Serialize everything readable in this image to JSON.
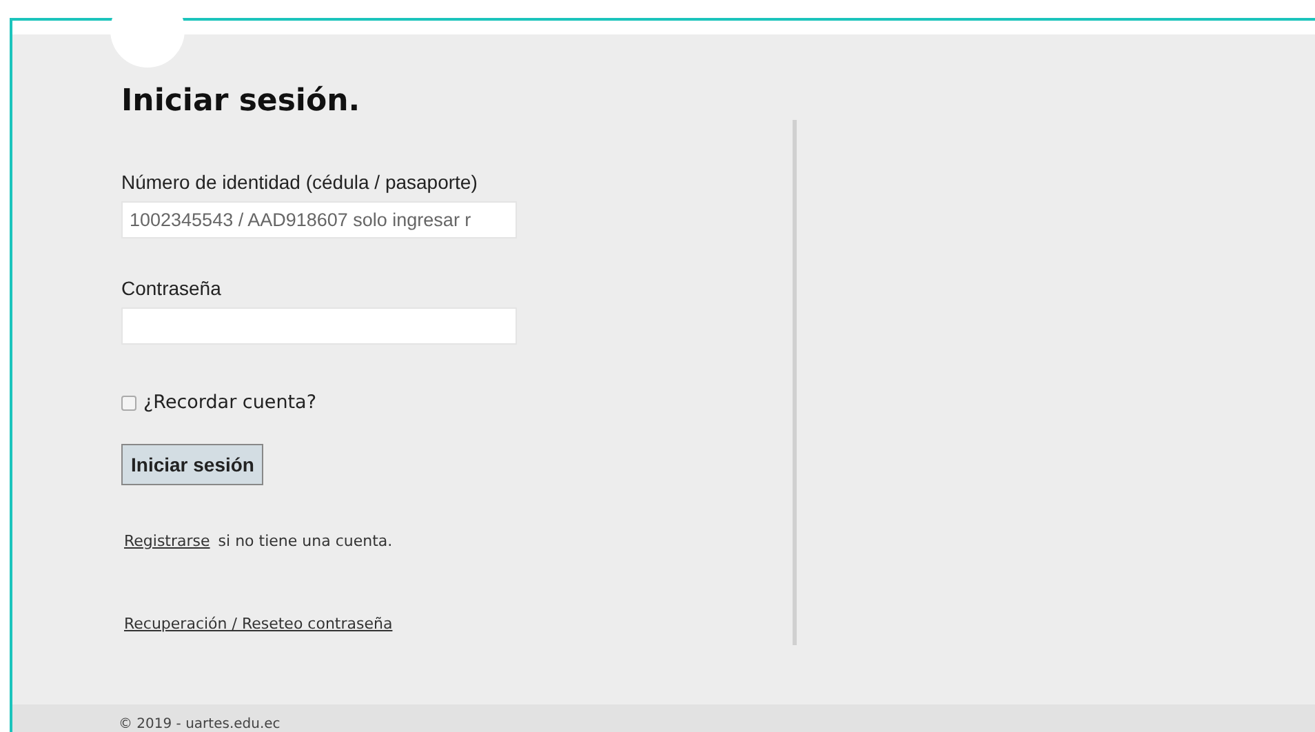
{
  "title": "Iniciar sesión.",
  "fields": [
    {
      "label": "Número de identidad (cédula / pasaporte)",
      "placeholder": "1002345543 / AAD918607 solo ingresar r"
    },
    {
      "label": "Contraseña"
    }
  ],
  "remember": {
    "label": "¿Recordar cuenta?",
    "checked": false
  },
  "submit": "Iniciar sesión",
  "register": {
    "link": "Registrarse",
    "text": "si no tiene una cuenta."
  },
  "reset_link": "Recuperación / Reseteo contraseña",
  "footer": "© 2019 - uartes.edu.ec"
}
